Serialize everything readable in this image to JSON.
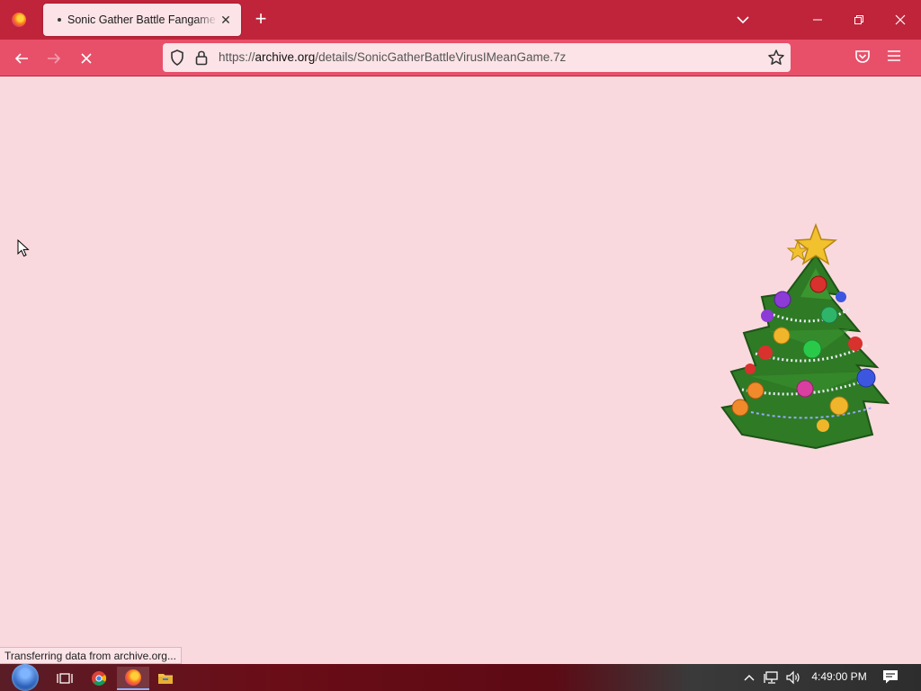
{
  "tab": {
    "title": "Sonic Gather Battle Fangame (N",
    "close": "✕"
  },
  "new_tab": "+",
  "url": {
    "scheme": "https://",
    "host": "archive.org",
    "path": "/details/SonicGatherBattleVirusIMeanGame.7z"
  },
  "status_text": "Transferring data from archive.org...",
  "clock": "4:49:00 PM",
  "colors": {
    "tabstrip": "#c0243a",
    "navbar": "#e8506a",
    "content": "#f9d9de",
    "urlbar": "#fbe3e7"
  },
  "icons": {
    "menu": "firefox-icon",
    "tab_list": "chevron-down-icon",
    "back": "back-arrow-icon",
    "forward": "forward-arrow-icon",
    "stop": "stop-loading-icon",
    "tracking": "shield-icon",
    "lock": "lock-icon",
    "bookmark": "star-icon",
    "pocket": "pocket-icon",
    "menu_hamburger": "hamburger-icon",
    "start": "windows-start-icon",
    "taskview": "task-view-icon",
    "chrome": "chrome-icon",
    "firefox": "firefox-icon",
    "explorer": "file-explorer-icon",
    "tray_up": "chevron-up-icon",
    "network": "network-icon",
    "volume": "volume-icon",
    "notification": "notification-icon"
  }
}
